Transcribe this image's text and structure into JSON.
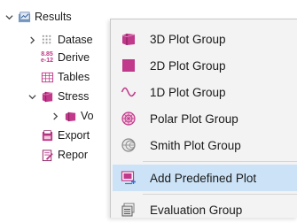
{
  "tree": {
    "items": [
      {
        "label": "Results",
        "icon": "results-folder-icon",
        "expanded": true
      },
      {
        "label": "Datase",
        "icon": "datasets-icon",
        "expanded": false
      },
      {
        "label": "Derive",
        "icon": "derived-values-icon",
        "badge": "8.85\ne-12"
      },
      {
        "label": "Tables",
        "icon": "table-icon"
      },
      {
        "label": "Stress",
        "icon": "plot-group-icon",
        "expanded": true
      },
      {
        "label": "Vo",
        "icon": "volume-plot-icon",
        "expanded": false
      },
      {
        "label": "Export",
        "icon": "export-icon"
      },
      {
        "label": "Repor",
        "icon": "report-icon"
      }
    ]
  },
  "menu": {
    "items": [
      {
        "label": "3D Plot Group",
        "icon": "3d-plot-group-icon"
      },
      {
        "label": "2D Plot Group",
        "icon": "2d-plot-group-icon"
      },
      {
        "label": "1D Plot Group",
        "icon": "1d-plot-group-icon"
      },
      {
        "label": "Polar Plot Group",
        "icon": "polar-plot-group-icon"
      },
      {
        "label": "Smith Plot Group",
        "icon": "smith-plot-group-icon"
      },
      {
        "label": "Add Predefined Plot",
        "icon": "add-predefined-plot-icon",
        "highlighted": true
      },
      {
        "label": "Evaluation Group",
        "icon": "evaluation-group-icon"
      }
    ]
  },
  "colors": {
    "highlight": "#cce3f7",
    "plot_magenta": "#c0398a",
    "menu_bg": "#f3f3f3"
  }
}
